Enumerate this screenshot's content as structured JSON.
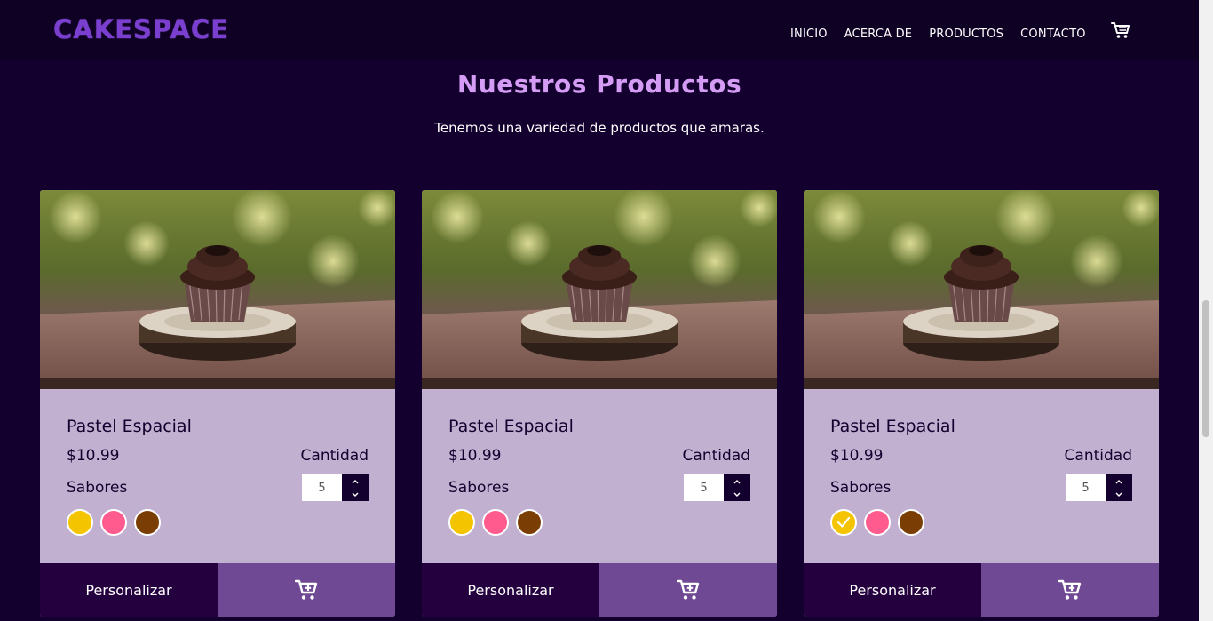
{
  "brand": {
    "logo_text": "CAKESPACE"
  },
  "nav": {
    "items": [
      {
        "label": "INICIO"
      },
      {
        "label": "ACERCA DE"
      },
      {
        "label": "PRODUCTOS"
      },
      {
        "label": "CONTACTO"
      }
    ],
    "cart_icon": "cart-icon"
  },
  "section": {
    "title": "Nuestros Productos",
    "subtitle": "Tenemos una variedad de productos que amaras."
  },
  "colors": {
    "background": "#14002e",
    "title": "#d49cf4",
    "card": "#c2b0d1",
    "button_dark": "#24003f",
    "button_light": "#6f4993",
    "flavor_yellow": "#f5c400",
    "flavor_pink": "#ff5b8f",
    "flavor_brown": "#7a3e05"
  },
  "products": [
    {
      "name": "Pastel Espacial",
      "price": "$10.99",
      "quantity_label": "Cantidad",
      "quantity_value": "5",
      "flavors_label": "Sabores",
      "selected_flavor": null,
      "customize_label": "Personalizar",
      "add_to_cart_icon": "add-to-cart-icon"
    },
    {
      "name": "Pastel Espacial",
      "price": "$10.99",
      "quantity_label": "Cantidad",
      "quantity_value": "5",
      "flavors_label": "Sabores",
      "selected_flavor": null,
      "customize_label": "Personalizar",
      "add_to_cart_icon": "add-to-cart-icon"
    },
    {
      "name": "Pastel Espacial",
      "price": "$10.99",
      "quantity_label": "Cantidad",
      "quantity_value": "5",
      "flavors_label": "Sabores",
      "selected_flavor": "yellow",
      "customize_label": "Personalizar",
      "add_to_cart_icon": "add-to-cart-icon"
    }
  ]
}
